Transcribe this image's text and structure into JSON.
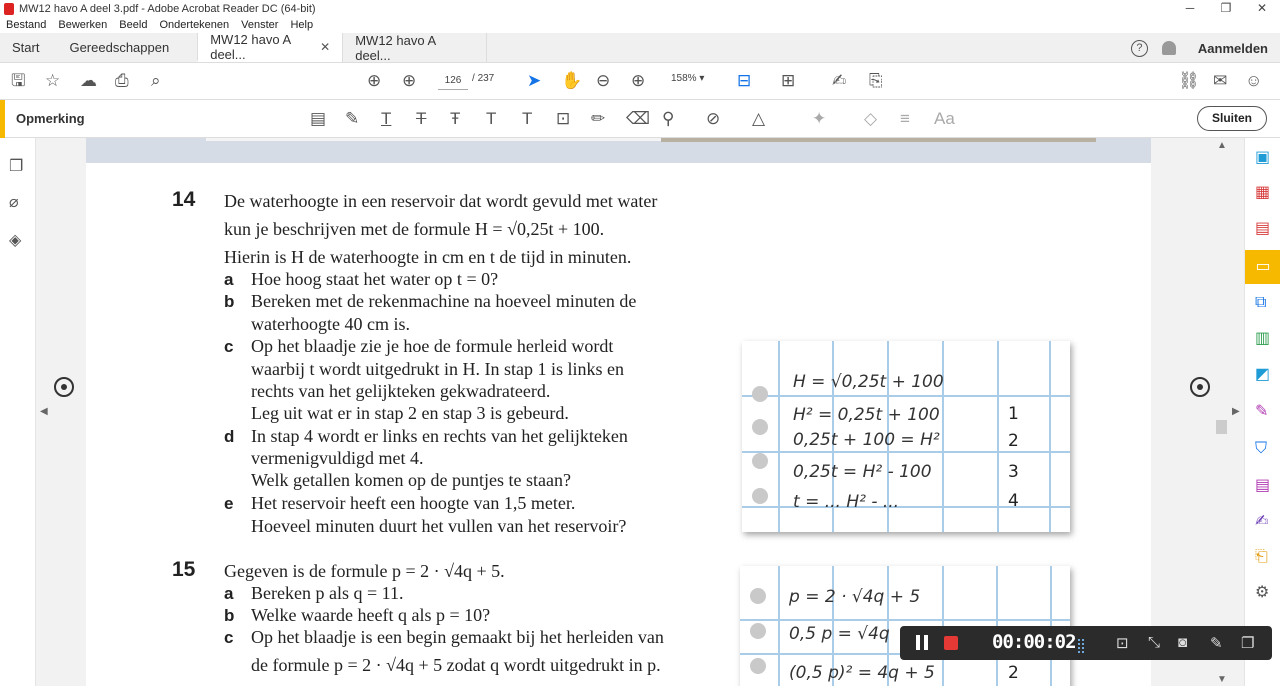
{
  "window": {
    "title": "MW12 havo A deel 3.pdf - Adobe Acrobat Reader DC (64-bit)",
    "minimize": "─",
    "maximize": "❐",
    "close": "✕"
  },
  "menu": [
    "Bestand",
    "Bewerken",
    "Beeld",
    "Ondertekenen",
    "Venster",
    "Help"
  ],
  "tabs": {
    "home": "Start",
    "tools": "Gereedschappen",
    "doc1": "MW12 havo A deel...",
    "doc1_close": "✕",
    "doc2": "MW12 havo A deel...",
    "help": "?",
    "signin": "Aanmelden"
  },
  "toolbar": {
    "page_current": "126",
    "page_sep": "/",
    "page_total": "237",
    "zoom": "158%"
  },
  "comment_bar": {
    "label": "Opmerking",
    "close_button": "Sluiten"
  },
  "exercise14": {
    "number": "14",
    "lines": [
      "De waterhoogte in een reservoir dat wordt gevuld met water",
      "kun je beschrijven met de formule H = √0,25t + 100.",
      "Hierin is H de waterhoogte in cm en t de tijd in minuten."
    ],
    "items": [
      {
        "label": "a",
        "lines": [
          "Hoe hoog staat het water op t = 0?"
        ]
      },
      {
        "label": "b",
        "lines": [
          "Bereken met de rekenmachine na hoeveel minuten de",
          "waterhoogte 40 cm is."
        ]
      },
      {
        "label": "c",
        "lines": [
          "Op het blaadje zie je hoe de formule herleid wordt",
          "waarbij t wordt uitgedrukt in H. In stap 1 is links en",
          "rechts van het gelijkteken gekwadrateerd.",
          "Leg uit wat er in stap 2 en stap 3 is gebeurd."
        ]
      },
      {
        "label": "d",
        "lines": [
          "In stap 4 wordt er links en rechts van het gelijkteken",
          "vermenigvuldigd met 4.",
          "Welk getallen komen op de puntjes te staan?"
        ]
      },
      {
        "label": "e",
        "lines": [
          "Het reservoir heeft een hoogte van 1,5 meter.",
          "Hoeveel minuten duurt het vullen van het reservoir?"
        ]
      }
    ],
    "card": {
      "rows": [
        "H = √0,25t + 100",
        "H² = 0,25t + 100",
        "0,25t + 100 = H²",
        "0,25t = H² - 100",
        "t = ... H² - ..."
      ],
      "steps": [
        "1",
        "2",
        "3",
        "4"
      ]
    }
  },
  "exercise15": {
    "number": "15",
    "lines": [
      "Gegeven is de formule p = 2 · √4q + 5."
    ],
    "items": [
      {
        "label": "a",
        "lines": [
          "Bereken p als q = 11."
        ]
      },
      {
        "label": "b",
        "lines": [
          "Welke waarde heeft q als p = 10?"
        ]
      },
      {
        "label": "c",
        "lines": [
          "Op het blaadje is een begin gemaakt bij het herleiden van",
          "de formule p = 2 · √4q + 5 zodat q wordt uitgedrukt in p."
        ]
      }
    ],
    "card": {
      "rows": [
        "p = 2 · √4q + 5",
        "0,5 p = √4q",
        "(0,5 p)² = 4q + 5"
      ],
      "steps": [
        "2"
      ]
    }
  },
  "recorder": {
    "time": "00:00:02"
  }
}
